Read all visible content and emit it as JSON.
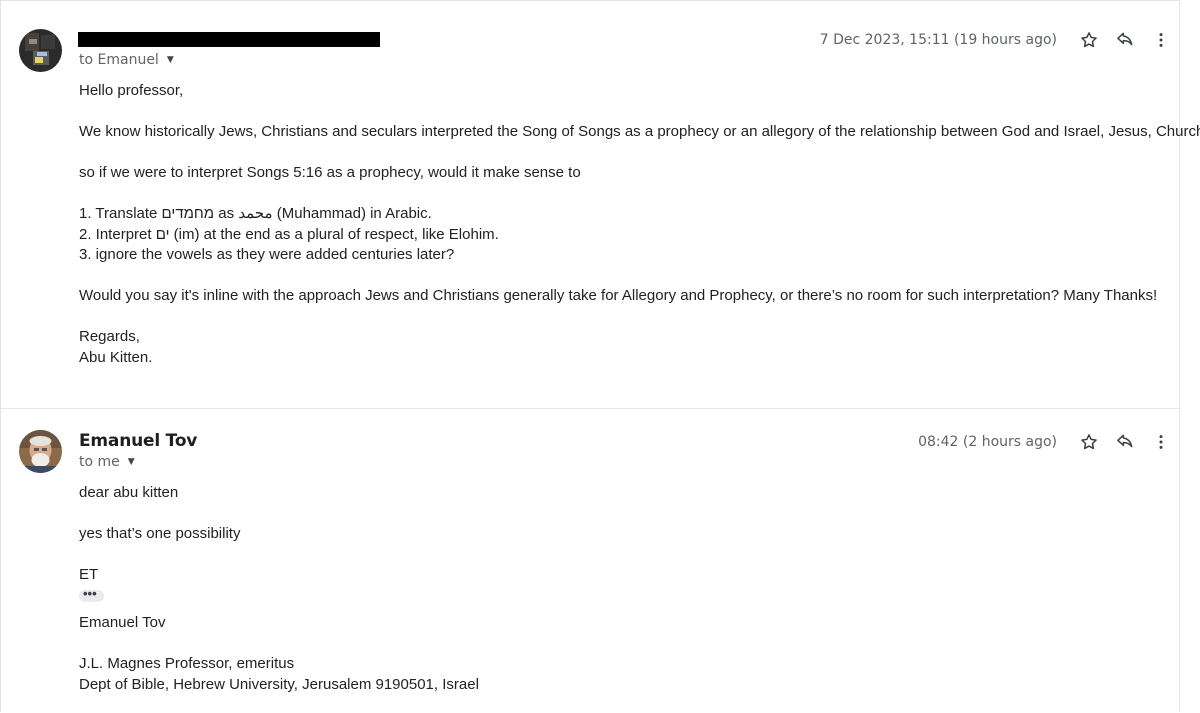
{
  "messages": [
    {
      "sender_name": "",
      "recipient": "to Emanuel",
      "timestamp": "7 Dec 2023, 15:11 (19 hours ago)",
      "body": {
        "greeting": "Hello professor,",
        "para1": "We know historically Jews, Christians and seculars interpreted the Song of Songs as a prophecy or an allegory of the relationship between God and Israel, Jesus, Church etc.",
        "para2": "so if we were to interpret Songs 5:16 as a prophecy, would it make sense to",
        "list": [
          "1. Translate מחמדים as محمد (Muhammad) in Arabic.",
          "2. Interpret ים (im) at the end as a plural of respect, like Elohim.",
          "3. ignore the vowels as they were added centuries later?"
        ],
        "para3": "Would you say it's inline with the approach Jews and Christians generally take for Allegory and Prophecy, or there’s no room for such interpretation? Many Thanks!",
        "closing": "Regards,",
        "signature": "Abu Kitten."
      }
    },
    {
      "sender_name": "Emanuel Tov",
      "recipient": "to me",
      "timestamp": "08:42 (2 hours ago)",
      "body": {
        "greeting": "dear abu kitten",
        "para1": "yes that’s one possibility",
        "initials": "ET",
        "sig_name": "Emanuel Tov",
        "sig_title": "J.L. Magnes Professor, emeritus",
        "sig_dept": "Dept of Bible, Hebrew University, Jerusalem 9190501, Israel"
      }
    }
  ],
  "icons": {
    "star": "star-icon",
    "reply": "reply-icon",
    "more": "more-vert-icon",
    "caret": "caret-down-icon",
    "ellipsis": "•••"
  },
  "colors": {
    "redaction": "#000000",
    "meta_text": "#5f6368",
    "body_text": "#222222"
  }
}
